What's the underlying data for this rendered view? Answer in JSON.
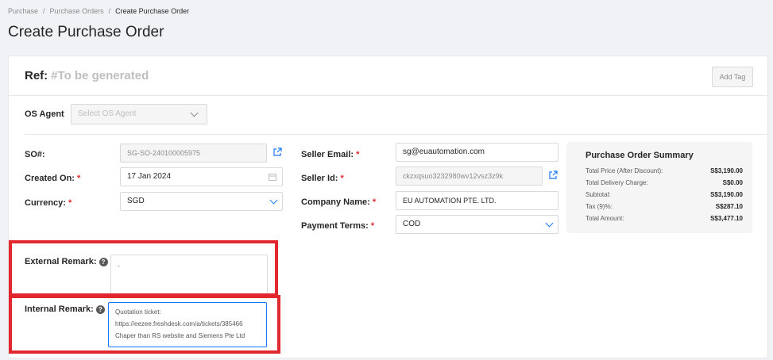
{
  "breadcrumb": {
    "items": [
      "Purchase",
      "Purchase Orders",
      "Create Purchase Order"
    ],
    "sep": "/"
  },
  "page_title": "Create Purchase Order",
  "ref": {
    "label": "Ref:",
    "value": "#To be generated"
  },
  "add_tag_label": "Add Tag",
  "os_agent": {
    "label": "OS Agent",
    "placeholder": "Select OS Agent"
  },
  "left_form": {
    "so_label": "SO#:",
    "so_value": "SG-SO-240100005975",
    "created_label": "Created On:",
    "created_value": "17 Jan 2024",
    "currency_label": "Currency:",
    "currency_value": "SGD"
  },
  "right_form": {
    "email_label": "Seller Email:",
    "email_value": "sg@euautomation.com",
    "seller_id_label": "Seller Id:",
    "seller_id_value": "ckzxqsuo3232980wv12vsz3z9k",
    "company_label": "Company Name:",
    "company_value": "EU AUTOMATION PTE. LTD.",
    "payment_label": "Payment Terms:",
    "payment_value": "COD"
  },
  "summary": {
    "title": "Purchase Order Summary",
    "rows": [
      {
        "label": "Total Price (After Discount):",
        "value": "S$3,190.00"
      },
      {
        "label": "Total Delivery Charge:",
        "value": "S$0.00"
      },
      {
        "label": "Subtotal:",
        "value": "S$3,190.00"
      },
      {
        "label": "Tax (9)%:",
        "value": "S$287.10"
      },
      {
        "label": "Total Amount:",
        "value": "S$3,477.10"
      }
    ]
  },
  "remarks": {
    "external_label": "External Remark:",
    "external_value": "-",
    "internal_label": "Internal Remark:",
    "internal_lines": [
      "Quotation ticket:",
      "https://eezee.freshdesk.com/a/tickets/385466",
      "Chaper than RS website and Siemens Pte Ltd"
    ]
  },
  "colors": {
    "highlight": "#e0282e",
    "accent": "#1677ff",
    "required": "#e0282e"
  },
  "icons": {
    "calendar": "calendar-icon",
    "external_link": "external-link-icon",
    "help": "question-circle-icon",
    "chevron": "chevron-down-icon"
  }
}
